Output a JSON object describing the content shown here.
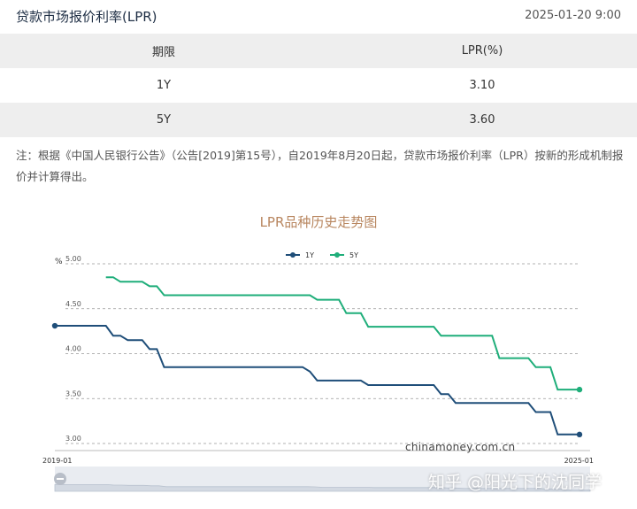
{
  "header": {
    "title": "贷款市场报价利率(LPR)",
    "datetime": "2025-01-20 9:00"
  },
  "table": {
    "headers": [
      "期限",
      "LPR(%)"
    ],
    "rows": [
      [
        "1Y",
        "3.10"
      ],
      [
        "5Y",
        "3.60"
      ]
    ]
  },
  "note": "注：根据《中国人民银行公告》（公告[2019]第15号），自2019年8月20日起，贷款市场报价利率（LPR）按新的形成机制报价并计算得出。",
  "watermark": "知乎 @阳光下的沈同学",
  "chart_data": {
    "type": "line",
    "title": "LPR品种历史走势图",
    "ylabel": "%",
    "ylim": [
      3.0,
      5.0
    ],
    "yticks": [
      "3.00",
      "3.50",
      "4.00",
      "4.50",
      "5.00"
    ],
    "xlim": [
      "2019-01",
      "2025-01"
    ],
    "xticks": [
      "2019-01",
      "2025-01"
    ],
    "grid": true,
    "legend": "top-center",
    "annotation": "chinamoney.com.cn",
    "series": [
      {
        "name": "1Y",
        "color": "#1f4e79",
        "points": [
          [
            "2019-01",
            4.31
          ],
          [
            "2019-08",
            4.31
          ],
          [
            "2019-09",
            4.2
          ],
          [
            "2019-10",
            4.2
          ],
          [
            "2019-11",
            4.15
          ],
          [
            "2019-12",
            4.15
          ],
          [
            "2020-01",
            4.15
          ],
          [
            "2020-02",
            4.05
          ],
          [
            "2020-03",
            4.05
          ],
          [
            "2020-04",
            3.85
          ],
          [
            "2021-11",
            3.85
          ],
          [
            "2021-12",
            3.8
          ],
          [
            "2022-01",
            3.7
          ],
          [
            "2022-07",
            3.7
          ],
          [
            "2022-08",
            3.65
          ],
          [
            "2023-05",
            3.65
          ],
          [
            "2023-06",
            3.55
          ],
          [
            "2023-07",
            3.55
          ],
          [
            "2023-08",
            3.45
          ],
          [
            "2024-06",
            3.45
          ],
          [
            "2024-07",
            3.35
          ],
          [
            "2024-09",
            3.35
          ],
          [
            "2024-10",
            3.1
          ],
          [
            "2025-01",
            3.1
          ]
        ]
      },
      {
        "name": "5Y",
        "color": "#1fae7a",
        "points": [
          [
            "2019-08",
            4.85
          ],
          [
            "2019-09",
            4.85
          ],
          [
            "2019-10",
            4.8
          ],
          [
            "2019-11",
            4.8
          ],
          [
            "2019-12",
            4.8
          ],
          [
            "2020-01",
            4.8
          ],
          [
            "2020-02",
            4.75
          ],
          [
            "2020-03",
            4.75
          ],
          [
            "2020-04",
            4.65
          ],
          [
            "2021-12",
            4.65
          ],
          [
            "2022-01",
            4.6
          ],
          [
            "2022-04",
            4.6
          ],
          [
            "2022-05",
            4.45
          ],
          [
            "2022-07",
            4.45
          ],
          [
            "2022-08",
            4.3
          ],
          [
            "2023-05",
            4.3
          ],
          [
            "2023-06",
            4.2
          ],
          [
            "2024-01",
            4.2
          ],
          [
            "2024-02",
            3.95
          ],
          [
            "2024-06",
            3.95
          ],
          [
            "2024-07",
            3.85
          ],
          [
            "2024-09",
            3.85
          ],
          [
            "2024-10",
            3.6
          ],
          [
            "2025-01",
            3.6
          ]
        ]
      }
    ]
  }
}
